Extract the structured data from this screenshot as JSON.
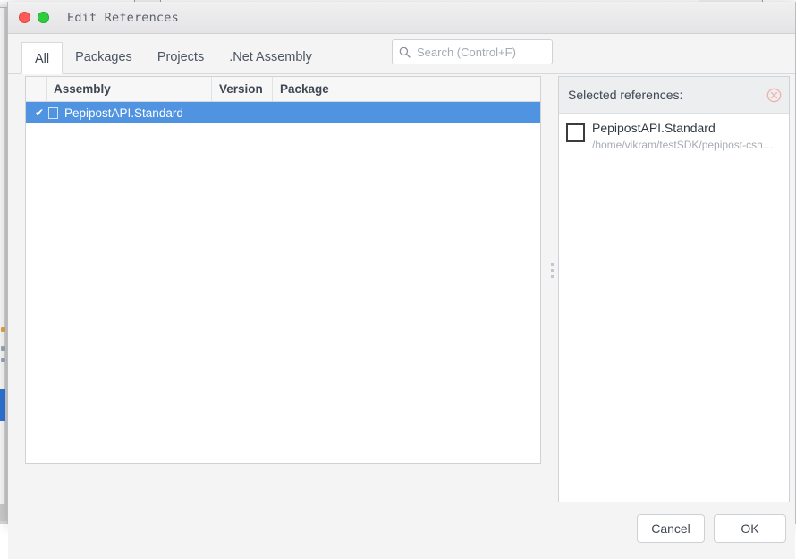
{
  "window": {
    "title": "Edit References",
    "controls": [
      {
        "name": "close",
        "color": "#fc5b57"
      },
      {
        "name": "zoom",
        "color": "#2fcc3f"
      }
    ]
  },
  "tabs": [
    {
      "label": "All",
      "active": true
    },
    {
      "label": "Packages",
      "active": false
    },
    {
      "label": "Projects",
      "active": false
    },
    {
      "label": ".Net Assembly",
      "active": false
    }
  ],
  "search": {
    "icon": "search-icon",
    "value": "",
    "placeholder": "Search (Control+F)"
  },
  "list": {
    "columns": [
      "",
      "Assembly",
      "Version",
      "Package"
    ],
    "rows": [
      {
        "checked": "✔",
        "icon": "assembly-file-icon",
        "assembly": "PepipostAPI.Standard",
        "version": "",
        "package": "",
        "selected": true
      }
    ]
  },
  "selected_panel": {
    "title": "Selected references:",
    "clear_icon": "circle-x-icon",
    "items": [
      {
        "icon": "assembly-box-icon",
        "name": "PepipostAPI.Standard",
        "path": "/home/vikram/testSDK/pepipost-csh…"
      }
    ]
  },
  "footer": {
    "cancel_label": "Cancel",
    "ok_label": "OK"
  },
  "colors": {
    "selection_blue": "#5093e1",
    "dialog_bg": "#f4f4f5",
    "panel_bg": "#ffffff",
    "header_bg": "#eceef0",
    "close_red": "#fc5b57",
    "zoom_green": "#2fcc3f",
    "clear_icon": "#f0b0a8"
  }
}
